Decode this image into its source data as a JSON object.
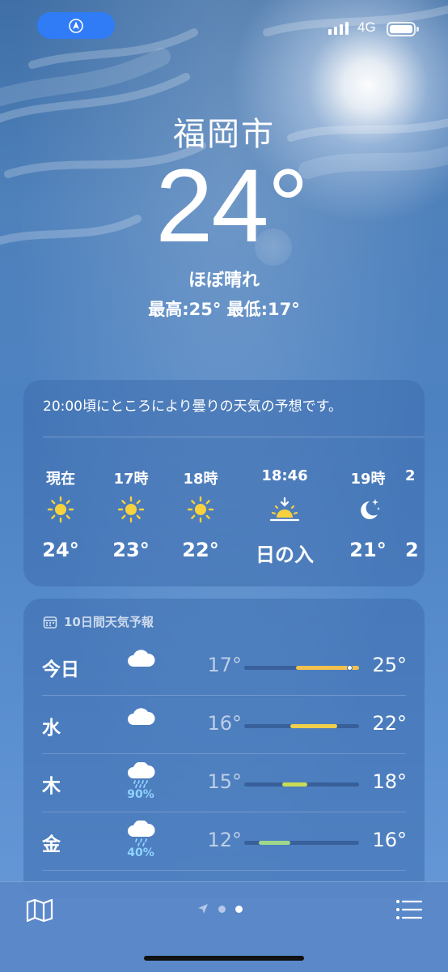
{
  "status_bar": {
    "network": "4G",
    "signal_bars": 4,
    "battery_level": 1.0
  },
  "header": {
    "city": "福岡市",
    "temperature": "24°",
    "condition": "ほぼ晴れ",
    "high_low": "最高:25°  最低:17°"
  },
  "hourly": {
    "summary": "20:00頃にところにより曇りの天気の予想です。",
    "items": [
      {
        "label": "現在",
        "icon": "sun-icon",
        "value": "24°"
      },
      {
        "label": "17時",
        "icon": "sun-icon",
        "value": "23°"
      },
      {
        "label": "18時",
        "icon": "sun-icon",
        "value": "22°"
      },
      {
        "label": "18:46",
        "icon": "sunset-icon",
        "value": "日の入"
      },
      {
        "label": "19時",
        "icon": "moon-stars-icon",
        "value": "21°"
      },
      {
        "label": "2",
        "icon": "moon-icon",
        "value": "2"
      }
    ]
  },
  "daily": {
    "title": "10日間天気予報",
    "rows": [
      {
        "day": "今日",
        "icon": "cloud-icon",
        "precip": "",
        "low": "17°",
        "high": "25°",
        "bar_start": 0.45,
        "bar_end": 1.0,
        "color": "#f2c14e",
        "current_marker": 0.92
      },
      {
        "day": "水",
        "icon": "cloud-icon",
        "precip": "",
        "low": "16°",
        "high": "22°",
        "bar_start": 0.4,
        "bar_end": 0.81,
        "color": "#f0d04a"
      },
      {
        "day": "木",
        "icon": "cloud-rain-icon",
        "precip": "90%",
        "low": "15°",
        "high": "18°",
        "bar_start": 0.33,
        "bar_end": 0.55,
        "color": "#c9dc55"
      },
      {
        "day": "金",
        "icon": "cloud-rain-icon",
        "precip": "40%",
        "low": "12°",
        "high": "16°",
        "bar_start": 0.13,
        "bar_end": 0.4,
        "color": "#9fd88a"
      }
    ]
  },
  "colors": {
    "location_pill": "#2f7cf6",
    "precip_text": "#8fd3ff"
  },
  "bottom_bar": {
    "icons": [
      "map-icon",
      "location-arrow-icon",
      "list-icon"
    ],
    "pages": 2,
    "active_page": 2
  }
}
